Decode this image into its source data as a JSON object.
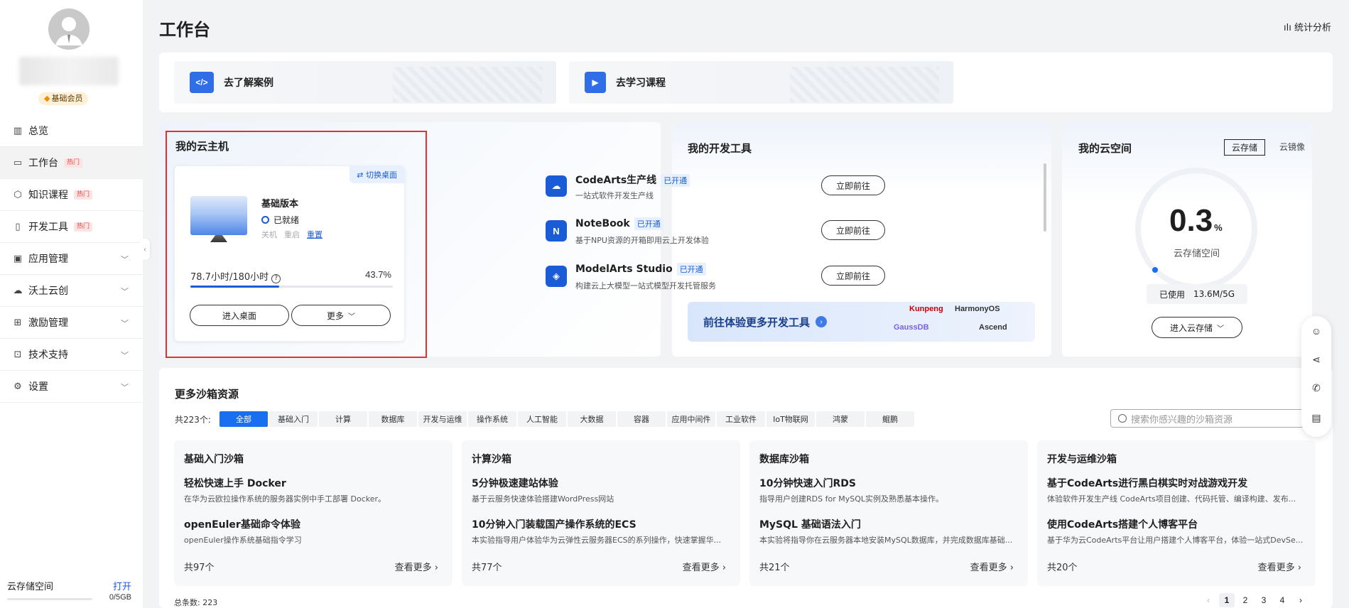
{
  "sidebar": {
    "member_badge": "基础会员",
    "items": [
      {
        "label": "总览",
        "icon": "chart-icon"
      },
      {
        "label": "工作台",
        "icon": "desktop-icon",
        "hot": "热门"
      },
      {
        "label": "知识课程",
        "icon": "cube-icon",
        "hot": "热门"
      },
      {
        "label": "开发工具",
        "icon": "code-file-icon",
        "hot": "热门"
      },
      {
        "label": "应用管理",
        "icon": "apps-icon"
      },
      {
        "label": "沃土云创",
        "icon": "cloud-icon"
      },
      {
        "label": "激励管理",
        "icon": "gift-icon"
      },
      {
        "label": "技术支持",
        "icon": "monitor-icon"
      },
      {
        "label": "设置",
        "icon": "gear-icon"
      }
    ],
    "storage_label": "云存储空间",
    "storage_open": "打开",
    "storage_value": "0/5GB"
  },
  "header": {
    "title": "工作台",
    "stats": "统计分析"
  },
  "banners": [
    {
      "label": "去了解案例"
    },
    {
      "label": "去学习课程"
    }
  ],
  "vm": {
    "title": "我的云主机",
    "switch": "切换桌面",
    "version": "基础版本",
    "status": "已就绪",
    "actions": [
      "关机",
      "重启",
      "重置"
    ],
    "usage": "78.7小时/180小时",
    "percent": "43.7%",
    "percent_value": 43.7,
    "enter": "进入桌面",
    "more": "更多"
  },
  "devtools": {
    "title": "我的开发工具",
    "items": [
      {
        "name": "CodeArts生产线",
        "badge": "已开通",
        "desc": "一站式软件开发生产线",
        "button": "立即前往"
      },
      {
        "name": "NoteBook",
        "badge": "已开通",
        "desc": "基于NPU资源的开箱即用云上开发体验",
        "button": "立即前往"
      },
      {
        "name": "ModelArts Studio",
        "badge": "已开通",
        "desc": "构建云上大模型一站式模型开发托管服务",
        "button": "立即前往"
      }
    ],
    "more": "前往体验更多开发工具",
    "logos": [
      "Kunpeng",
      "HarmonyOS",
      "GaussDB",
      "Ascend"
    ]
  },
  "cloud": {
    "title": "我的云空间",
    "tabs": [
      "云存储",
      "云镜像"
    ],
    "value": "0.3",
    "unit": "%",
    "label": "云存储空间",
    "used_label": "已使用",
    "used_value": "13.6M/5G",
    "enter": "进入云存储"
  },
  "sandbox": {
    "title": "更多沙箱资源",
    "count": "共223个:",
    "chips": [
      "全部",
      "基础入门",
      "计算",
      "数据库",
      "开发与运维",
      "操作系统",
      "人工智能",
      "大数据",
      "容器",
      "应用中间件",
      "工业软件",
      "IoT物联网",
      "鸿蒙",
      "鲲鹏"
    ],
    "search_placeholder": "搜索你感兴趣的沙箱资源",
    "cards": [
      {
        "title": "基础入门沙箱",
        "items": [
          {
            "name": "轻松快速上手 Docker",
            "desc": "在华为云欧拉操作系统的服务器实例中手工部署 Docker。"
          },
          {
            "name": "openEuler基础命令体验",
            "desc": "openEuler操作系统基础指令学习"
          }
        ],
        "total": "共97个",
        "more": "查看更多"
      },
      {
        "title": "计算沙箱",
        "items": [
          {
            "name": "5分钟极速建站体验",
            "desc": "基于云服务快速体验搭建WordPress网站"
          },
          {
            "name": "10分钟入门装载国产操作系统的ECS",
            "desc": "本实验指导用户体验华为云弹性云服务器ECS的系列操作，快速掌握华..."
          }
        ],
        "total": "共77个",
        "more": "查看更多"
      },
      {
        "title": "数据库沙箱",
        "items": [
          {
            "name": "10分钟快速入门RDS",
            "desc": "指导用户创建RDS for MySQL实例及熟悉基本操作。"
          },
          {
            "name": "MySQL 基础语法入门",
            "desc": "本实验将指导你在云服务器本地安装MySQL数据库，并完成数据库基础..."
          }
        ],
        "total": "共21个",
        "more": "查看更多"
      },
      {
        "title": "开发与运维沙箱",
        "items": [
          {
            "name": "基于CodeArts进行黑白棋实时对战游戏开发",
            "desc": "体验软件开发生产线 CodeArts项目创建、代码托管、编译构建、发布..."
          },
          {
            "name": "使用CodeArts搭建个人博客平台",
            "desc": "基于华为云CodeArts平台让用户搭建个人博客平台，体验一站式DevSe..."
          }
        ],
        "total": "共20个",
        "more": "查看更多"
      }
    ],
    "total_label": "总条数:  223",
    "pages": [
      "1",
      "2",
      "3",
      "4"
    ]
  },
  "colors": {
    "accent": "#1a6ff0",
    "highlight_border": "#e53030"
  }
}
